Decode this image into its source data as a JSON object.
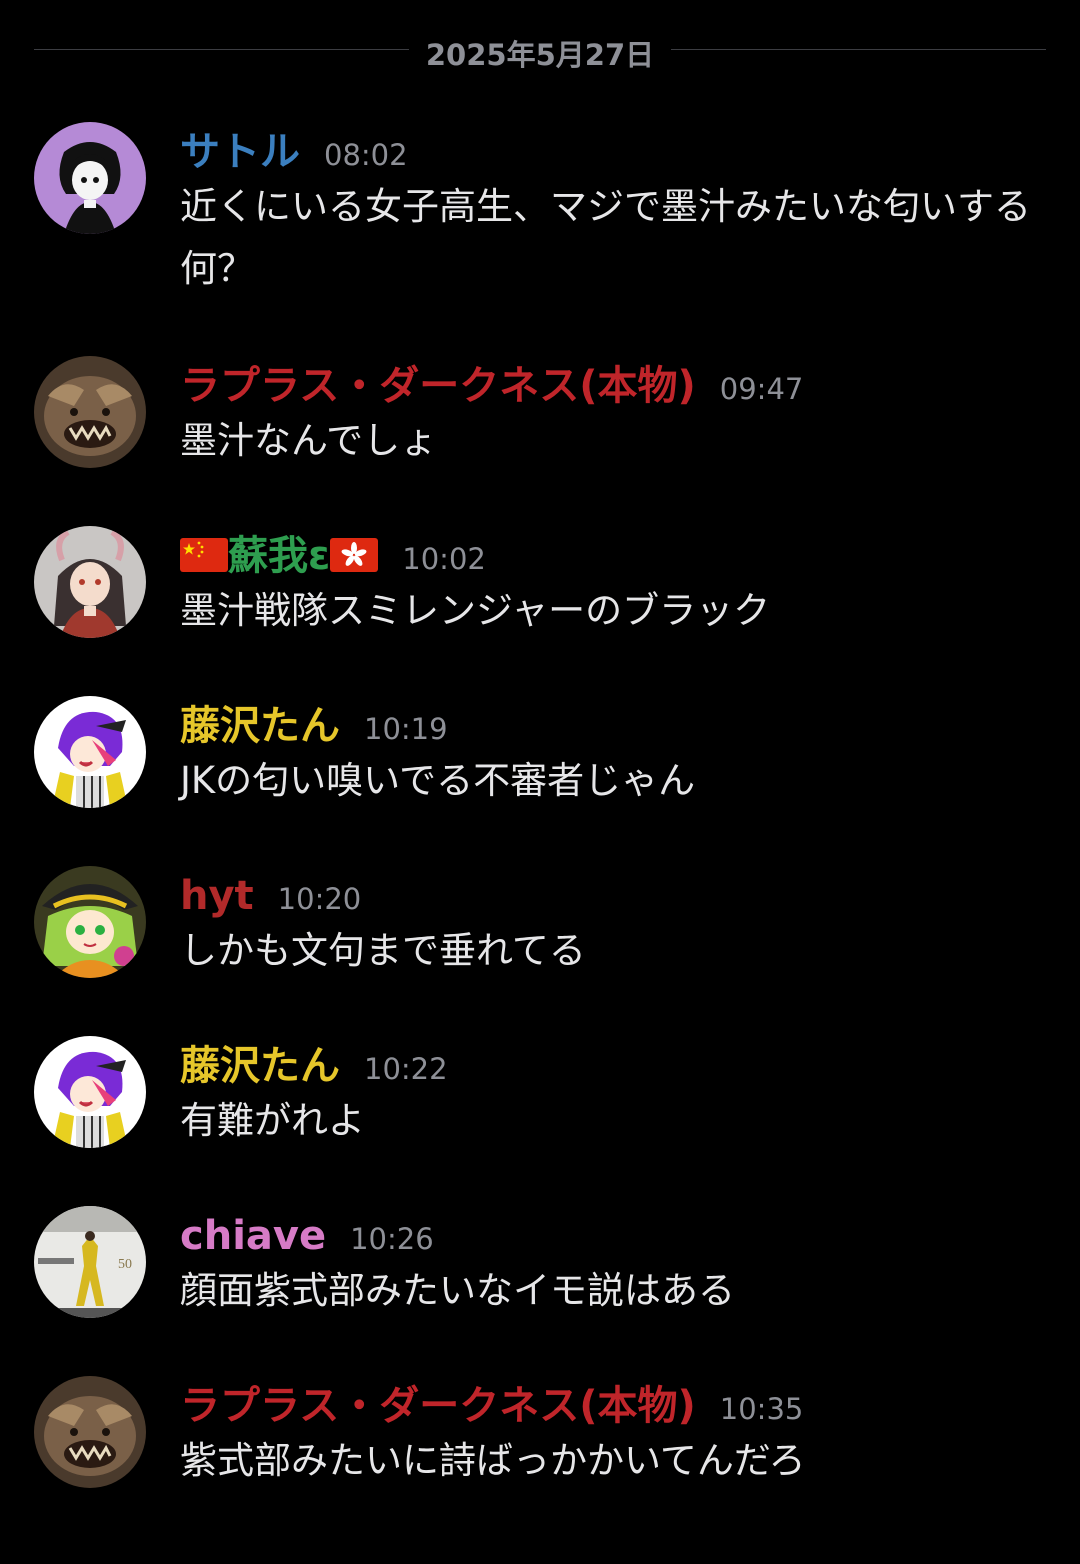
{
  "date_divider": "2025年5月27日",
  "messages": [
    {
      "username": "サトル",
      "name_color": "#3b7fbf",
      "time": "08:02",
      "text": "近くにいる女子高生、マジで墨汁みたいな匂いする\n何？",
      "avatar": "avatar-purple-girl"
    },
    {
      "username": "ラプラス・ダークネス(本物)",
      "name_color": "#c0252a",
      "time": "09:47",
      "text": "墨汁なんでしょ",
      "avatar": "avatar-monster"
    },
    {
      "username_prefix_flag": "china-flag-icon",
      "username": "蘇我ε",
      "username_suffix_flag": "hongkong-flag-icon",
      "name_color": "#2e9e4f",
      "time": "10:02",
      "text": "墨汁戦隊スミレンジャーのブラック",
      "avatar": "avatar-horned-girl"
    },
    {
      "username": "藤沢たん",
      "name_color": "#e6c62a",
      "time": "10:19",
      "text": "JKの匂い嗅いでる不審者じゃん",
      "avatar": "avatar-purple-hair"
    },
    {
      "username": "hyt",
      "name_color": "#b22a2a",
      "time": "10:20",
      "text": "しかも文句まで垂れてる",
      "avatar": "avatar-green-hair"
    },
    {
      "username": "藤沢たん",
      "name_color": "#e6c62a",
      "time": "10:22",
      "text": "有難がれよ",
      "avatar": "avatar-purple-hair"
    },
    {
      "username": "chiave",
      "name_color": "#d67bc6",
      "time": "10:26",
      "text": "顔面紫式部みたいなイモ説はある",
      "avatar": "avatar-statue"
    },
    {
      "username": "ラプラス・ダークネス(本物)",
      "name_color": "#c0252a",
      "time": "10:35",
      "text": "紫式部みたいに詩ばっかかいてんだろ",
      "avatar": "avatar-monster"
    }
  ]
}
